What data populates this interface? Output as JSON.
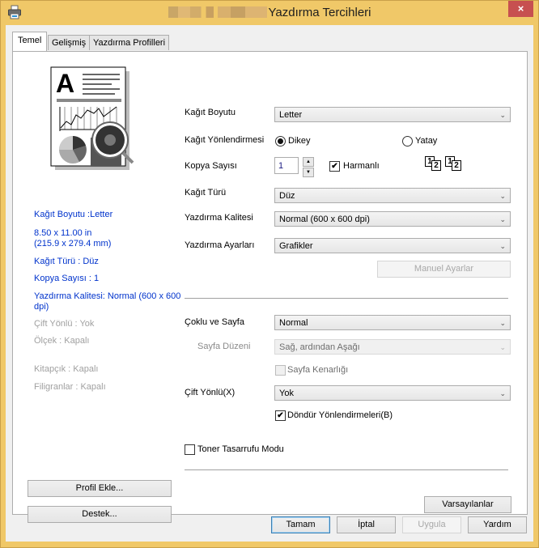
{
  "window": {
    "title": "Yazdırma Tercihleri",
    "close_label": "×"
  },
  "tabs": [
    {
      "label": "Temel",
      "active": true
    },
    {
      "label": "Gelişmiş",
      "active": false
    },
    {
      "label": "Yazdırma Profilleri",
      "active": false
    }
  ],
  "summary": {
    "paper_size": "Kağıt Boyutu :Letter",
    "dims_in": "8.50 x 11.00 in",
    "dims_mm": "(215.9 x 279.4 mm)",
    "media_type": "Kağıt Türü : Düz",
    "copies": "Kopya Sayısı : 1",
    "quality_line1": "Yazdırma Kalitesi: Normal (600 x 600",
    "quality_line2": "dpi)",
    "duplex": "Çift Yönlü : Yok",
    "scaling": "Ölçek : Kapalı",
    "booklet": "Kitapçık : Kapalı",
    "watermark": "Filigranlar : Kapalı"
  },
  "settings": {
    "paper_size": {
      "label": "Kağıt Boyutu",
      "value": "Letter"
    },
    "orientation": {
      "label": "Kağıt Yönlendirmesi",
      "portrait": "Dikey",
      "landscape": "Yatay",
      "selected": "Dikey"
    },
    "copies": {
      "label": "Kopya Sayısı",
      "value": "1",
      "collate_label": "Harmanlı",
      "collate_checked": true
    },
    "media_type": {
      "label": "Kağıt Türü",
      "value": "Düz"
    },
    "print_quality": {
      "label": "Yazdırma Kalitesi",
      "value": "Normal (600 x 600 dpi)"
    },
    "print_settings": {
      "label": "Yazdırma Ayarları",
      "value": "Grafikler"
    },
    "manual_settings_button": "Manuel Ayarlar",
    "multiple_page": {
      "label": "Çoklu ve Sayfa",
      "value": "Normal"
    },
    "page_order": {
      "label": "Sayfa Düzeni",
      "value": "Sağ, ardından Aşağı"
    },
    "border_line": {
      "label": "Sayfa Kenarlığı",
      "checked": false
    },
    "duplex": {
      "label": "Çift Yönlü(X)",
      "value": "Yok"
    },
    "rotate": {
      "label": "Döndür Yönlendirmeleri(B)",
      "checked": true
    },
    "toner_save": {
      "label": "Toner Tasarrufu Modu",
      "checked": false
    }
  },
  "buttons": {
    "add_profile": "Profil Ekle...",
    "support": "Destek...",
    "defaults": "Varsayılanlar",
    "ok": "Tamam",
    "cancel": "İptal",
    "apply": "Uygula",
    "help": "Yardım"
  },
  "collate_glyph": {
    "first": "1",
    "second": "2"
  },
  "icons": {
    "dropdown": "⌄",
    "check": "✔",
    "spin_up": "▲",
    "spin_down": "▼"
  }
}
